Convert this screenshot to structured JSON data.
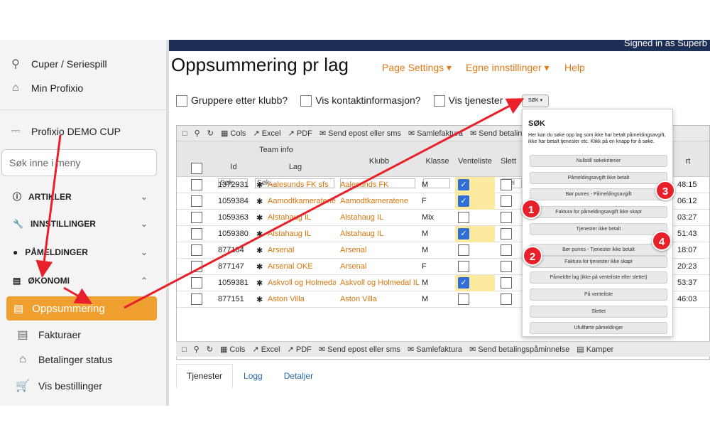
{
  "sidebar": {
    "items": [
      {
        "label": "Cuper / Seriespill",
        "icon": "search-icon"
      },
      {
        "label": "Min Profixio",
        "icon": "home-icon"
      },
      {
        "label": "Profixio DEMO CUP",
        "icon": "trophy-icon"
      }
    ],
    "search_placeholder": "Søk inne i meny",
    "groups": [
      {
        "label": "ARTIKLER",
        "icon": "info-icon"
      },
      {
        "label": "INNSTILLINGER",
        "icon": "wrench-icon"
      },
      {
        "label": "PÅMELDINGER",
        "icon": "users-icon"
      },
      {
        "label": "ØKONOMI",
        "icon": "money-icon"
      }
    ],
    "active": "Oppsummering",
    "sub": [
      {
        "label": "Fakturaer",
        "icon": "invoice-icon"
      },
      {
        "label": "Betalinger status",
        "icon": "bank-icon"
      },
      {
        "label": "Vis bestillinger",
        "icon": "cart-icon"
      }
    ]
  },
  "header": {
    "signed_in": "Signed in as Superb",
    "title": "Oppsummering pr lag",
    "menu": [
      "Page Settings",
      "Egne innstillinger",
      "Help"
    ]
  },
  "filters": {
    "group_by_club": "Gruppere etter klubb?",
    "contact": "Vis kontaktinformasjon?",
    "services": "Vis tjenester",
    "sok": "SØK"
  },
  "toolbar": [
    "Cols",
    "Excel",
    "PDF",
    "Send epost eller sms",
    "Samlefaktura",
    "Send betaling"
  ],
  "bottom_toolbar": [
    "Cols",
    "Excel",
    "PDF",
    "Send epost eller sms",
    "Samlefaktura",
    "Send betalingspåminnelse",
    "Kamper"
  ],
  "columns": {
    "team_info": "Team info",
    "id": "Id",
    "lag": "Lag",
    "klubb": "Klubb",
    "klasse": "Klasse",
    "venteliste": "Venteliste",
    "slett": "Slett",
    "start": "rt"
  },
  "filter_values": {
    "id": "Søk...",
    "lag": "Søk...",
    "klubb": "-",
    "klasse": "-",
    "slett": "Nei"
  },
  "rows": [
    {
      "id": "1372931",
      "lag": "Aalesunds FK sfs",
      "klubb": "Aalesunds FK",
      "klasse": "M",
      "vent": true,
      "time": "48:15"
    },
    {
      "id": "1059384",
      "lag": "Aamodtkameratene",
      "klubb": "Aamodtkameratene",
      "klasse": "F",
      "vent": true,
      "time": "06:12"
    },
    {
      "id": "1059363",
      "lag": "Alstahaug IL",
      "klubb": "Alstahaug IL",
      "klasse": "Mix",
      "vent": false,
      "time": "03:27"
    },
    {
      "id": "1059380",
      "lag": "Alstahaug IL",
      "klubb": "Alstahaug IL",
      "klasse": "M",
      "vent": true,
      "time": "51:43"
    },
    {
      "id": "877184",
      "lag": "Arsenal",
      "klubb": "Arsenal",
      "klasse": "M",
      "vent": false,
      "time": "18:07"
    },
    {
      "id": "877147",
      "lag": "Arsenal OKE",
      "klubb": "Arsenal",
      "klasse": "F",
      "vent": false,
      "time": "20:23"
    },
    {
      "id": "1059381",
      "lag": "Askvoll og Holmedal",
      "klubb": "Askvoll og Holmedal IL",
      "klasse": "M",
      "vent": true,
      "time": "53:37"
    },
    {
      "id": "877151",
      "lag": "Aston Villa",
      "klubb": "Aston Villa",
      "klasse": "M",
      "vent": false,
      "time": "46:03"
    }
  ],
  "tabs": [
    "Tjenester",
    "Logg",
    "Detaljer"
  ],
  "popup": {
    "title": "SØK",
    "desc": "Her kan du søke opp lag som ikke har betalt påmeldingsavgift, ikke har betalt tjenester etc. Klikk på en knapp for å søke.",
    "buttons": [
      "Nullstill søkekriterier",
      "Påmeldingsavgift ikke betalt",
      "Bør purres - Påmeldingsavgift",
      "Faktura for påmeldingsavgift ikke skapt",
      "Tjenester ikke betalt",
      "Bør purres - Tjenester ikke betalt",
      "Faktura for tjenester ikke skapt",
      "Påmeldte lag (ikke på venteliste eller slettet)",
      "På venteliste",
      "Slettet",
      "Ufullførte påmeldinger"
    ]
  },
  "badges": [
    "1",
    "2",
    "3",
    "4"
  ],
  "colors": {
    "accent": "#f0a030",
    "link": "#d9770f",
    "arrow": "#e8202a"
  }
}
